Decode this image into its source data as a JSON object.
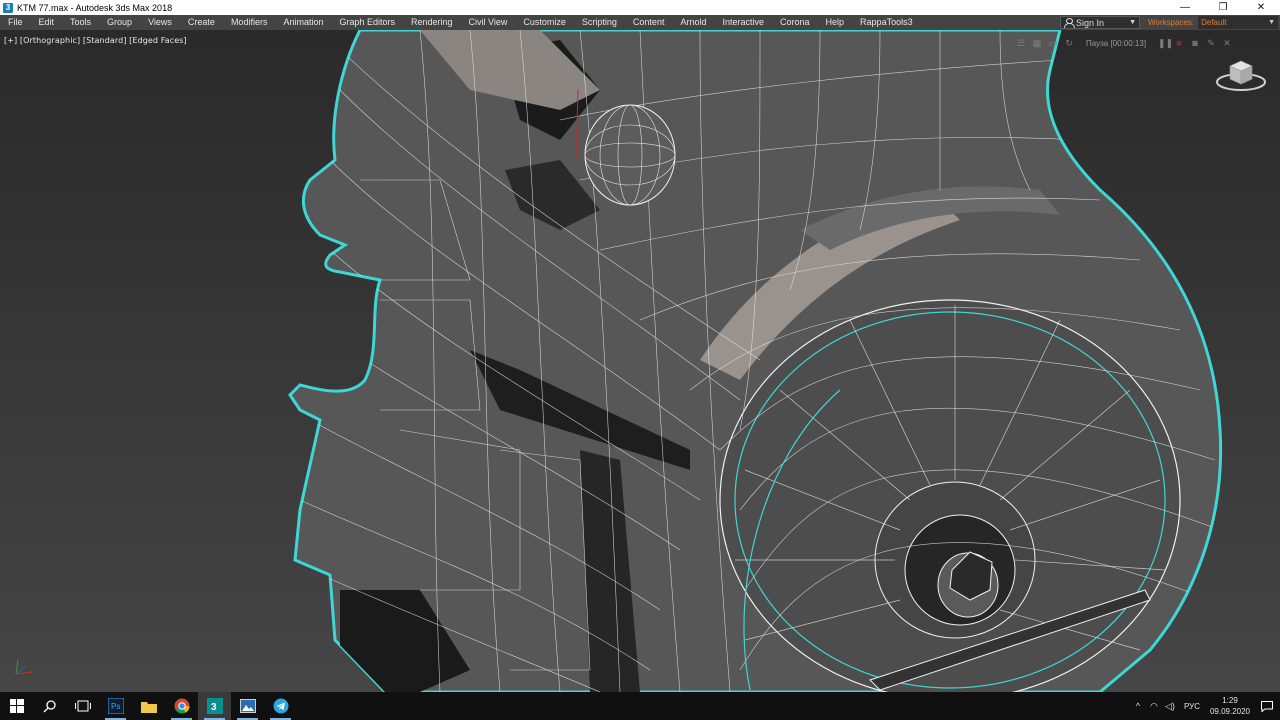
{
  "window": {
    "title": "KTM 77.max - Autodesk 3ds Max 2018",
    "icon_label": "3",
    "minimize": "—",
    "restore": "❐",
    "close": "✕"
  },
  "menu": {
    "items": [
      "File",
      "Edit",
      "Tools",
      "Group",
      "Views",
      "Create",
      "Modifiers",
      "Animation",
      "Graph Editors",
      "Rendering",
      "Civil View",
      "Customize",
      "Scripting",
      "Content",
      "Arnold",
      "Interactive",
      "Corona",
      "Help",
      "RappaTools3"
    ],
    "sign_in": "Sign In",
    "workspaces_label": "Workspaces:",
    "workspaces_value": "Default"
  },
  "viewport": {
    "label": "[+] [Orthographic] [Standard] [Edged Faces]",
    "playback_text": "Пауза [00:00:13]",
    "colors": {
      "selection_outline": "#3fd6d6",
      "mesh_fill": "#555555",
      "wire": "#e8e8e8"
    }
  },
  "taskbar": {
    "icons": [
      "windows-start-icon",
      "search-icon",
      "task-view-icon",
      "photoshop-icon",
      "file-explorer-icon",
      "chrome-icon",
      "3dsmax-icon",
      "image-viewer-icon",
      "telegram-icon"
    ],
    "ps_label": "Ps",
    "max_label": "3",
    "lang": "РУС",
    "time": "1:29",
    "date": "09.09.2020"
  }
}
